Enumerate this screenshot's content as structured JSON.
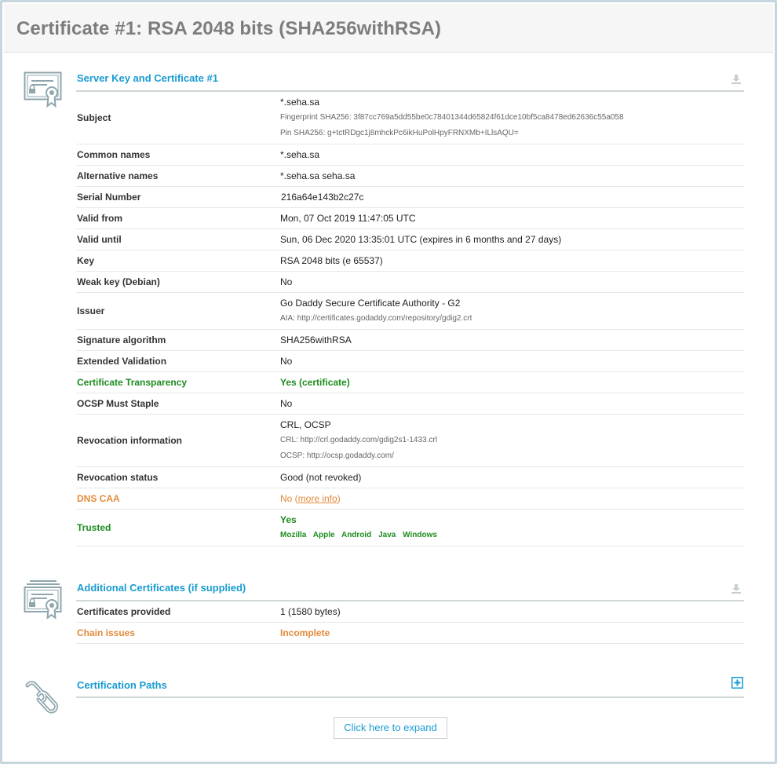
{
  "header": {
    "title": "Certificate #1: RSA 2048 bits (SHA256withRSA)"
  },
  "server_key": {
    "title": "Server Key and Certificate #1",
    "subject": {
      "label": "Subject",
      "value": "*.seha.sa",
      "fingerprint": "Fingerprint SHA256: 3f87cc769a5dd55be0c78401344d65824f61dce10bf5ca8478ed62636c55a058",
      "pin": "Pin SHA256: g+tctRDgc1j8mhckPc6ikHuPolHpyFRNXMb+ILlsAQU="
    },
    "common_names": {
      "label": "Common names",
      "value": "*.seha.sa"
    },
    "alt_names": {
      "label": "Alternative names",
      "value": "*.seha.sa seha.sa"
    },
    "serial": {
      "label": "Serial Number",
      "value": "216a64e143b2c27c"
    },
    "valid_from": {
      "label": "Valid from",
      "value": "Mon, 07 Oct 2019 11:47:05 UTC"
    },
    "valid_until": {
      "label": "Valid until",
      "value": "Sun, 06 Dec 2020 13:35:01 UTC (expires in 6 months and 27 days)"
    },
    "key": {
      "label": "Key",
      "value": "RSA 2048 bits (e 65537)"
    },
    "weak_key": {
      "label": "Weak key (Debian)",
      "value": "No"
    },
    "issuer": {
      "label": "Issuer",
      "value": "Go Daddy Secure Certificate Authority - G2",
      "aia": "AIA: http://certificates.godaddy.com/repository/gdig2.crt"
    },
    "sig_alg": {
      "label": "Signature algorithm",
      "value": "SHA256withRSA"
    },
    "ev": {
      "label": "Extended Validation",
      "value": "No"
    },
    "ct": {
      "label": "Certificate Transparency",
      "value": "Yes (certificate)"
    },
    "ocsp_staple": {
      "label": "OCSP Must Staple",
      "value": "No"
    },
    "revocation_info": {
      "label": "Revocation information",
      "value": "CRL, OCSP",
      "crl": "CRL: http://crl.godaddy.com/gdig2s1-1433.crl",
      "ocsp": "OCSP: http://ocsp.godaddy.com/"
    },
    "revocation_status": {
      "label": "Revocation status",
      "value": "Good (not revoked)"
    },
    "dns_caa": {
      "label": "DNS CAA",
      "value_prefix": "No (",
      "link": "more info",
      "value_suffix": ")"
    },
    "trusted": {
      "label": "Trusted",
      "value": "Yes",
      "platforms": [
        "Mozilla",
        "Apple",
        "Android",
        "Java",
        "Windows"
      ]
    }
  },
  "additional": {
    "title": "Additional Certificates (if supplied)",
    "provided": {
      "label": "Certificates provided",
      "value": "1 (1580 bytes)"
    },
    "chain": {
      "label": "Chain issues",
      "value": "Incomplete"
    }
  },
  "paths": {
    "title": "Certification Paths",
    "expand_label": "Click here to expand"
  },
  "colors": {
    "accent": "#1a9bd1",
    "good": "#1c8c1f",
    "warn": "#e38a3a"
  }
}
